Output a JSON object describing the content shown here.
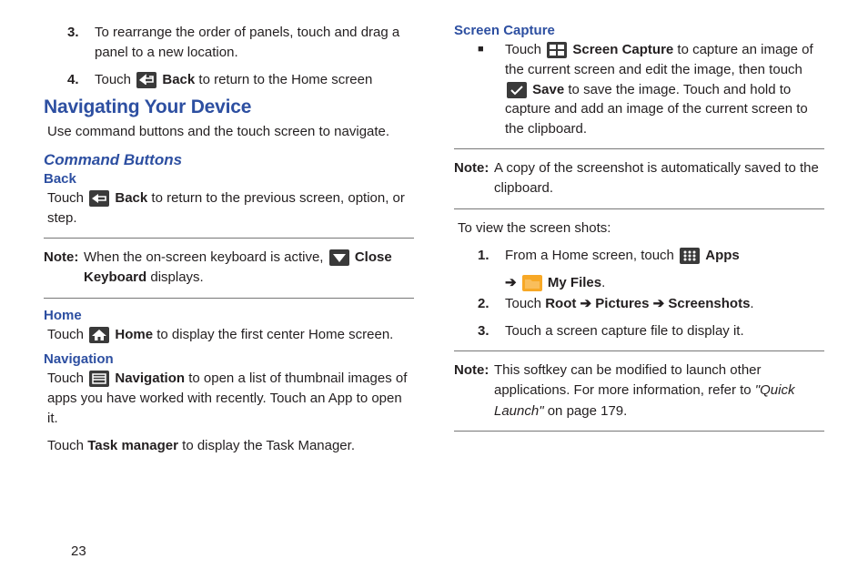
{
  "left": {
    "item3": {
      "num": "3.",
      "text": "To rearrange the order of panels, touch and drag a panel to a new location."
    },
    "item4": {
      "num": "4.",
      "pre": "Touch ",
      "bold": "Back",
      "post": " to return to the Home screen"
    },
    "h1": "Navigating Your Device",
    "intro": "Use command buttons and the touch screen to navigate.",
    "h2": "Command Buttons",
    "back": {
      "title": "Back",
      "pre": "Touch ",
      "bold": "Back",
      "post": " to return to the previous screen, option, or step."
    },
    "note1": {
      "label": "Note:",
      "pre": "When the on-screen keyboard is active, ",
      "bold": "Close Keyboard",
      "post": " displays."
    },
    "home": {
      "title": "Home",
      "pre": "Touch ",
      "bold": "Home",
      "post": " to display the first center Home screen."
    },
    "nav": {
      "title": "Navigation",
      "pre": "Touch ",
      "bold": "Navigation",
      "post": " to open a list of thumbnail images of apps you have worked with recently. Touch an App to open it.",
      "tm_pre": "Touch ",
      "tm_bold": "Task manager",
      "tm_post": " to display the Task Manager."
    }
  },
  "right": {
    "sc_title": "Screen Capture",
    "bullet": {
      "pre": "Touch ",
      "bold1": "Screen Capture",
      "mid1": " to capture an image of the current screen and edit the image, then touch ",
      "bold2": "Save",
      "post": " to save the image. Touch and hold to capture and add an image of the current screen to the clipboard."
    },
    "note2": {
      "label": "Note:",
      "text": "A copy of the screenshot is automatically saved to the clipboard."
    },
    "view": "To view the screen shots:",
    "s1": {
      "num": "1.",
      "pre": "From a Home screen, touch ",
      "apps": "Apps",
      "arrow": "➔",
      "myfiles": "My Files",
      "dot": "."
    },
    "s2": {
      "num": "2.",
      "pre": "Touch ",
      "b1": "Root",
      "a1": " ➔ ",
      "b2": "Pictures",
      "a2": " ➔ ",
      "b3": "Screenshots",
      "dot": "."
    },
    "s3": {
      "num": "3.",
      "text": "Touch a screen capture file to display it."
    },
    "note3": {
      "label": "Note:",
      "pre": "This softkey can be modified to launch other applications. For more information, refer to ",
      "ital": "\"Quick Launch\"",
      "post": "  on page 179."
    }
  },
  "page": "23"
}
